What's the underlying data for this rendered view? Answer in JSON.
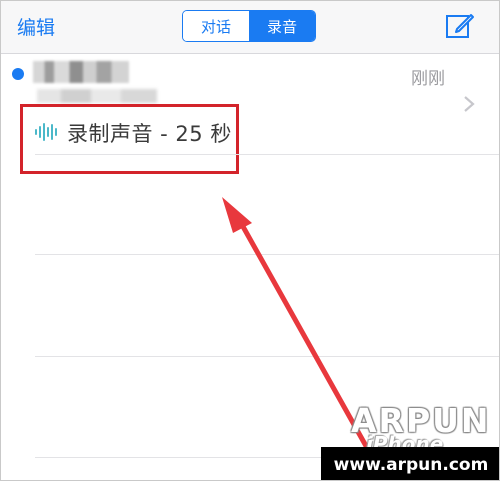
{
  "navbar": {
    "edit_label": "编辑",
    "segments": [
      {
        "label": "对话",
        "active": false
      },
      {
        "label": "录音",
        "active": true
      }
    ],
    "compose_icon": "compose-icon",
    "accent_color": "#1a7bf2"
  },
  "conversation": {
    "time": "刚刚",
    "unread": true,
    "message": "录制声音 - 25 秒",
    "message_icon": "audio-waveform-icon"
  },
  "annotation": {
    "highlight_color": "#d3232a",
    "arrow_color": "#e8383d"
  },
  "watermark": {
    "brand": "ARPUN",
    "sub": "iPhone",
    "url": "www.arpun.com"
  }
}
